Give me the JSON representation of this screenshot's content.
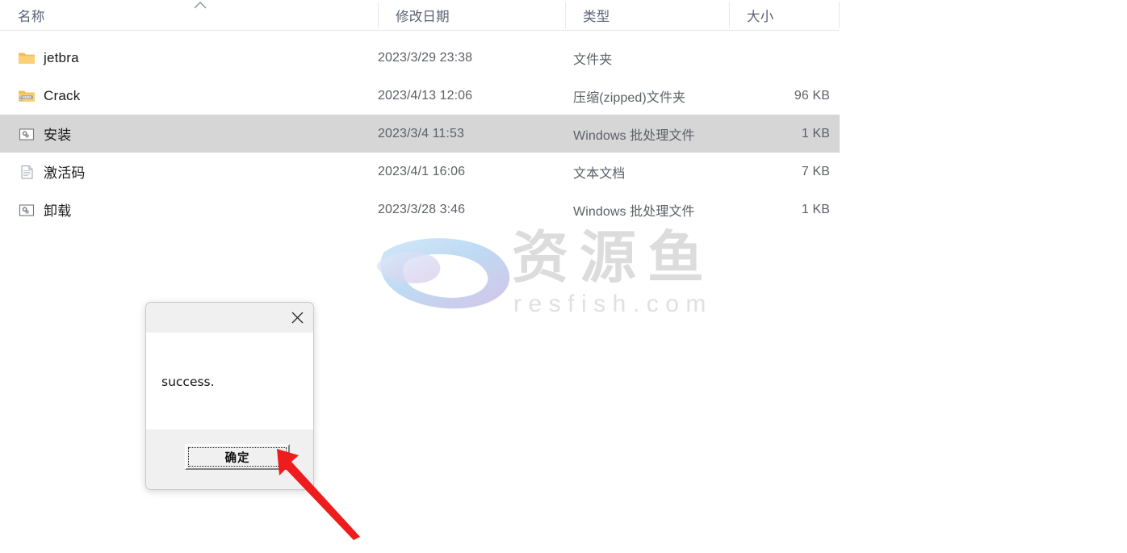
{
  "explorer": {
    "columns": [
      {
        "key": "name",
        "label": "名称",
        "sorted": "asc"
      },
      {
        "key": "modified",
        "label": "修改日期",
        "sorted": ""
      },
      {
        "key": "type",
        "label": "类型",
        "sorted": ""
      },
      {
        "key": "size",
        "label": "大小",
        "sorted": ""
      }
    ],
    "rows": [
      {
        "name": "jetbra",
        "modified": "2023/3/29 23:38",
        "type": "文件夹",
        "size": "",
        "icon": "folder-icon",
        "selected": false
      },
      {
        "name": "Crack",
        "modified": "2023/4/13 12:06",
        "type": "压缩(zipped)文件夹",
        "size": "96 KB",
        "icon": "zip-folder-icon",
        "selected": false
      },
      {
        "name": "安装",
        "modified": "2023/3/4 11:53",
        "type": "Windows 批处理文件",
        "size": "1 KB",
        "icon": "batch-file-icon",
        "selected": true
      },
      {
        "name": "激活码",
        "modified": "2023/4/1 16:06",
        "type": "文本文档",
        "size": "7 KB",
        "icon": "text-file-icon",
        "selected": false
      },
      {
        "name": "卸载",
        "modified": "2023/3/28 3:46",
        "type": "Windows 批处理文件",
        "size": "1 KB",
        "icon": "batch-file-icon",
        "selected": false
      }
    ]
  },
  "dialog": {
    "message": "success.",
    "ok_label": "确定",
    "close_icon": "close-icon"
  },
  "watermark": {
    "brand_cn": "资源鱼",
    "domain": "resfish.com",
    "logo_icon": "fish-swoosh-logo"
  },
  "annotation": {
    "arrow_icon": "red-arrow-pointer",
    "arrow_color": "#ee1d1d"
  },
  "colors": {
    "selection": "#d6d6d6",
    "header_text": "#5a6275",
    "body_text": "#1b1b1b",
    "secondary_text": "#5d6067",
    "folder": "#f6c35a",
    "dialog_face": "#f0f0f0",
    "watermark_gray": "#dcdcdc"
  }
}
